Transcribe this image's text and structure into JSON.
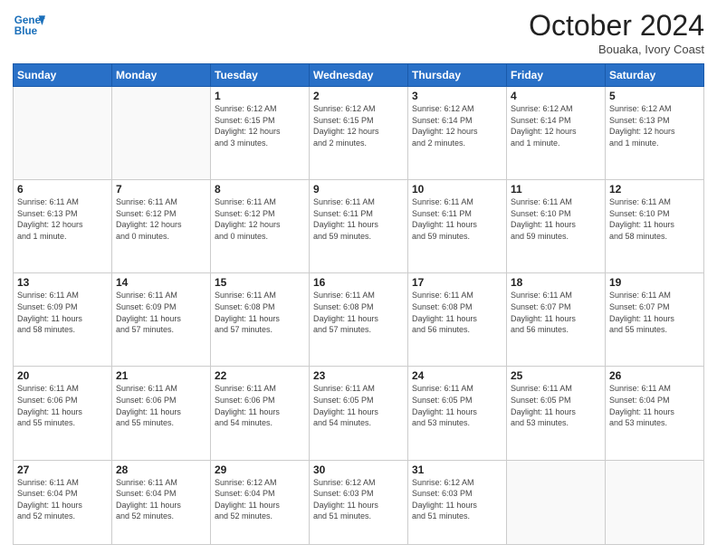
{
  "header": {
    "logo_line1": "General",
    "logo_line2": "Blue",
    "month": "October 2024",
    "location": "Bouaka, Ivory Coast"
  },
  "weekdays": [
    "Sunday",
    "Monday",
    "Tuesday",
    "Wednesday",
    "Thursday",
    "Friday",
    "Saturday"
  ],
  "weeks": [
    [
      {
        "day": "",
        "info": ""
      },
      {
        "day": "",
        "info": ""
      },
      {
        "day": "1",
        "info": "Sunrise: 6:12 AM\nSunset: 6:15 PM\nDaylight: 12 hours\nand 3 minutes."
      },
      {
        "day": "2",
        "info": "Sunrise: 6:12 AM\nSunset: 6:15 PM\nDaylight: 12 hours\nand 2 minutes."
      },
      {
        "day": "3",
        "info": "Sunrise: 6:12 AM\nSunset: 6:14 PM\nDaylight: 12 hours\nand 2 minutes."
      },
      {
        "day": "4",
        "info": "Sunrise: 6:12 AM\nSunset: 6:14 PM\nDaylight: 12 hours\nand 1 minute."
      },
      {
        "day": "5",
        "info": "Sunrise: 6:12 AM\nSunset: 6:13 PM\nDaylight: 12 hours\nand 1 minute."
      }
    ],
    [
      {
        "day": "6",
        "info": "Sunrise: 6:11 AM\nSunset: 6:13 PM\nDaylight: 12 hours\nand 1 minute."
      },
      {
        "day": "7",
        "info": "Sunrise: 6:11 AM\nSunset: 6:12 PM\nDaylight: 12 hours\nand 0 minutes."
      },
      {
        "day": "8",
        "info": "Sunrise: 6:11 AM\nSunset: 6:12 PM\nDaylight: 12 hours\nand 0 minutes."
      },
      {
        "day": "9",
        "info": "Sunrise: 6:11 AM\nSunset: 6:11 PM\nDaylight: 11 hours\nand 59 minutes."
      },
      {
        "day": "10",
        "info": "Sunrise: 6:11 AM\nSunset: 6:11 PM\nDaylight: 11 hours\nand 59 minutes."
      },
      {
        "day": "11",
        "info": "Sunrise: 6:11 AM\nSunset: 6:10 PM\nDaylight: 11 hours\nand 59 minutes."
      },
      {
        "day": "12",
        "info": "Sunrise: 6:11 AM\nSunset: 6:10 PM\nDaylight: 11 hours\nand 58 minutes."
      }
    ],
    [
      {
        "day": "13",
        "info": "Sunrise: 6:11 AM\nSunset: 6:09 PM\nDaylight: 11 hours\nand 58 minutes."
      },
      {
        "day": "14",
        "info": "Sunrise: 6:11 AM\nSunset: 6:09 PM\nDaylight: 11 hours\nand 57 minutes."
      },
      {
        "day": "15",
        "info": "Sunrise: 6:11 AM\nSunset: 6:08 PM\nDaylight: 11 hours\nand 57 minutes."
      },
      {
        "day": "16",
        "info": "Sunrise: 6:11 AM\nSunset: 6:08 PM\nDaylight: 11 hours\nand 57 minutes."
      },
      {
        "day": "17",
        "info": "Sunrise: 6:11 AM\nSunset: 6:08 PM\nDaylight: 11 hours\nand 56 minutes."
      },
      {
        "day": "18",
        "info": "Sunrise: 6:11 AM\nSunset: 6:07 PM\nDaylight: 11 hours\nand 56 minutes."
      },
      {
        "day": "19",
        "info": "Sunrise: 6:11 AM\nSunset: 6:07 PM\nDaylight: 11 hours\nand 55 minutes."
      }
    ],
    [
      {
        "day": "20",
        "info": "Sunrise: 6:11 AM\nSunset: 6:06 PM\nDaylight: 11 hours\nand 55 minutes."
      },
      {
        "day": "21",
        "info": "Sunrise: 6:11 AM\nSunset: 6:06 PM\nDaylight: 11 hours\nand 55 minutes."
      },
      {
        "day": "22",
        "info": "Sunrise: 6:11 AM\nSunset: 6:06 PM\nDaylight: 11 hours\nand 54 minutes."
      },
      {
        "day": "23",
        "info": "Sunrise: 6:11 AM\nSunset: 6:05 PM\nDaylight: 11 hours\nand 54 minutes."
      },
      {
        "day": "24",
        "info": "Sunrise: 6:11 AM\nSunset: 6:05 PM\nDaylight: 11 hours\nand 53 minutes."
      },
      {
        "day": "25",
        "info": "Sunrise: 6:11 AM\nSunset: 6:05 PM\nDaylight: 11 hours\nand 53 minutes."
      },
      {
        "day": "26",
        "info": "Sunrise: 6:11 AM\nSunset: 6:04 PM\nDaylight: 11 hours\nand 53 minutes."
      }
    ],
    [
      {
        "day": "27",
        "info": "Sunrise: 6:11 AM\nSunset: 6:04 PM\nDaylight: 11 hours\nand 52 minutes."
      },
      {
        "day": "28",
        "info": "Sunrise: 6:11 AM\nSunset: 6:04 PM\nDaylight: 11 hours\nand 52 minutes."
      },
      {
        "day": "29",
        "info": "Sunrise: 6:12 AM\nSunset: 6:04 PM\nDaylight: 11 hours\nand 52 minutes."
      },
      {
        "day": "30",
        "info": "Sunrise: 6:12 AM\nSunset: 6:03 PM\nDaylight: 11 hours\nand 51 minutes."
      },
      {
        "day": "31",
        "info": "Sunrise: 6:12 AM\nSunset: 6:03 PM\nDaylight: 11 hours\nand 51 minutes."
      },
      {
        "day": "",
        "info": ""
      },
      {
        "day": "",
        "info": ""
      }
    ]
  ]
}
